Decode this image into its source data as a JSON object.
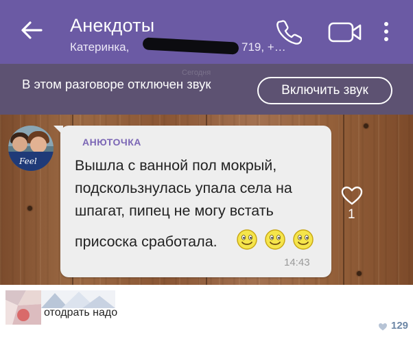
{
  "header": {
    "title": "Анекдоты",
    "subtitle_start": "Катеринка, ",
    "subtitle_end": "719, +…",
    "bg_color": "#6b5aa4"
  },
  "mute_bar": {
    "ghost_date": "Сегодня",
    "text": "В этом разговоре отключен звук",
    "button_label": "Включить звук",
    "bg_color": "#5d5272"
  },
  "message": {
    "sender": "АНЮТОЧКА",
    "lines": [
      "Вышла с ванной пол мокрый,",
      "подскользнулась упала села на",
      "шпагат, пипец не могу встать",
      "присоска сработала."
    ],
    "time": "14:43",
    "like_count": "1",
    "avatar_signature": "Feel"
  },
  "comment": {
    "text": "отодрать надо",
    "likes": "129"
  },
  "icons": [
    "back-arrow-icon",
    "phone-icon",
    "video-call-icon",
    "more-options-icon",
    "heart-icon",
    "smiley-icon"
  ]
}
